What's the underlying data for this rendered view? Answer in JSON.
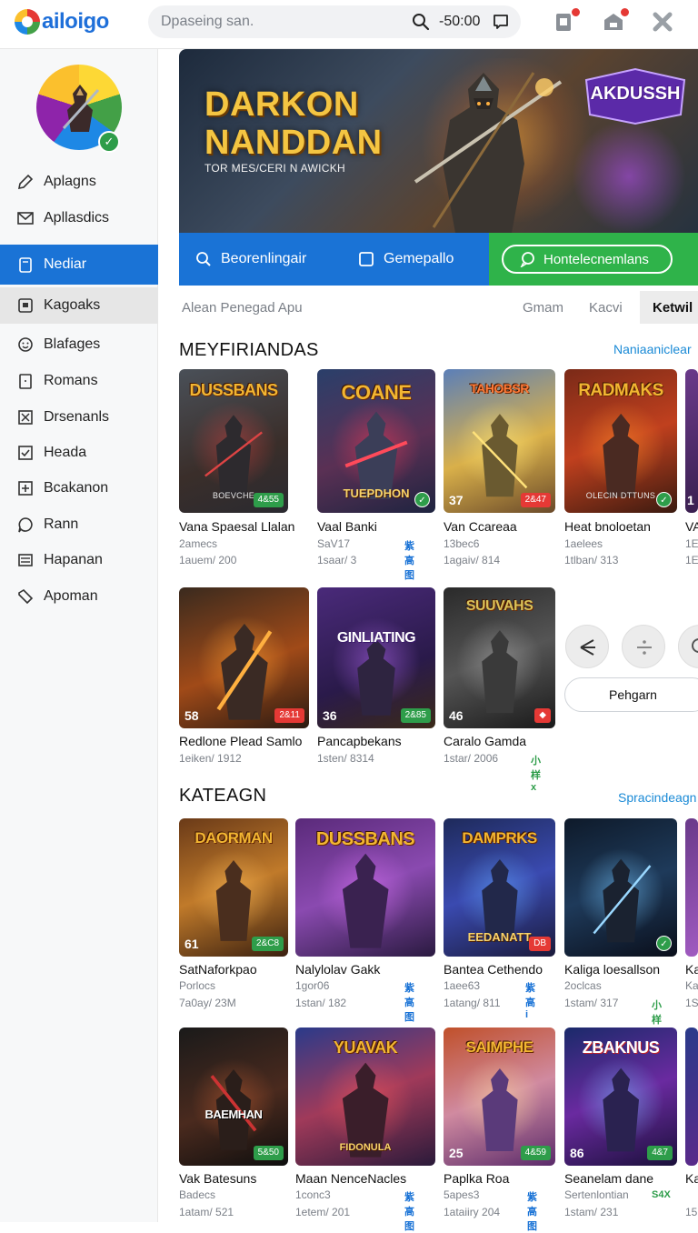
{
  "header": {
    "logo_text": "ailoigo",
    "search_placeholder": "Dpaseing san.",
    "search_time": "-50:00"
  },
  "sidebar": {
    "items": [
      {
        "label": "Aplagns",
        "icon": "edit-icon"
      },
      {
        "label": "Apllasdics",
        "icon": "mail-icon"
      },
      {
        "label": "Nediar",
        "icon": "tablet-icon"
      },
      {
        "label": "Kagoaks",
        "icon": "book-icon"
      },
      {
        "label": "Blafages",
        "icon": "smiley-icon"
      },
      {
        "label": "Romans",
        "icon": "door-icon"
      },
      {
        "label": "Drsenanls",
        "icon": "x-box-icon"
      },
      {
        "label": "Heada",
        "icon": "check-box-icon"
      },
      {
        "label": "Bcakanon",
        "icon": "plus-box-icon"
      },
      {
        "label": "Rann",
        "icon": "chat-icon"
      },
      {
        "label": "Hapanan",
        "icon": "list-icon"
      },
      {
        "label": "Apoman",
        "icon": "tag-icon"
      }
    ]
  },
  "hero": {
    "title_line1": "DARKON",
    "title_line2": "NANDDAN",
    "subtitle": "TOR MES/CERI N AWICKH",
    "badge": "AKDUSSH",
    "slides": 4,
    "active_slide": 1
  },
  "actions": {
    "btn1": "Beorenlingair",
    "btn2": "Gemepallo",
    "btn3": "Hontelecnemlans"
  },
  "filters": {
    "label": "Alean Penegad Apu",
    "tabs": [
      "Gmam",
      "Kacvi",
      "Ketwil"
    ],
    "active_tab": "Ketwil"
  },
  "section1": {
    "title": "MEYFIRIANDAS",
    "link": "Naniaaniclear",
    "cards": [
      {
        "logo": "DUSSBANS",
        "name": "Vana Spaesal Llalan",
        "meta": "2amecs",
        "stat": "1auem/ 200",
        "band": "BOEVCHE",
        "tag_label": "4&55",
        "tag_color": "#2e9d4a",
        "tag_text": ""
      },
      {
        "logo": "COANE",
        "name": "Vaal Banki",
        "meta": "SaV17",
        "stat": "1saar/ 3",
        "band": "TUEPDHON",
        "tag_label": "check",
        "tag_color": "#2e9d4a",
        "tag_text": "紫高图"
      },
      {
        "logo": "TAHOBSR",
        "name": "Van Ccareaa",
        "meta": "13bec6",
        "stat": "1agaiv/ 814",
        "num": "37",
        "tag_label": "2&47",
        "tag_color": "#e53935",
        "tag_text": ""
      },
      {
        "logo": "RADMAKS",
        "name": "Heat bnoloetan",
        "meta": "1aelees",
        "stat": "1tlban/ 313",
        "band": "OLECIN DTTUNS",
        "tag_label": "check",
        "tag_color": "#2e9d4a",
        "tag_text": ""
      },
      {
        "logo": "",
        "name": "VA",
        "meta": "1E",
        "stat": "1E",
        "num": "1",
        "tag_label": "",
        "tag_color": "",
        "tag_text": ""
      }
    ]
  },
  "section1_row2": {
    "cards": [
      {
        "logo": "",
        "name": "Redlone Plead Samlo",
        "meta": "1eiken/ 1912",
        "num": "58",
        "tag_label": "2&11",
        "tag_color": "#e53935"
      },
      {
        "logo": "GINLIATING",
        "name": "Pancapbekans",
        "meta": "1sten/ 8314",
        "num": "36",
        "tag_label": "2&85",
        "tag_color": "#2e9d4a"
      },
      {
        "logo": "SUUVAHS",
        "name": "Caralo Gamda",
        "meta": "1star/ 2006",
        "num": "46",
        "tag_label": "◆",
        "tag_color": "#e53935",
        "tag_text": "小样x"
      }
    ],
    "pill": "Pehgarn"
  },
  "section2": {
    "title": "KATEAGN",
    "link": "Spracindeagn",
    "cards": [
      {
        "logo": "DAORMAN",
        "name": "SatNaforkpao",
        "meta": "Porlocs",
        "stat": "7a0ay/ 23M",
        "num": "61",
        "tag_label": "2&C8",
        "tag_color": "#2e9d4a",
        "tag_text": ""
      },
      {
        "logo": "DUSSBANS",
        "name": "Nalylolav Gakk",
        "meta": "1gor06",
        "stat": "1stan/ 182",
        "tag_label": "",
        "tag_color": "",
        "tag_text": "紫高图"
      },
      {
        "logo": "DAMPRKS",
        "name": "Bantea Cethendo",
        "meta": "1aee63",
        "stat": "1atang/ 811",
        "band": "EEDANATT",
        "tag_label": "DB",
        "tag_color": "#e53935",
        "tag_text": "紫高i"
      },
      {
        "logo": "",
        "name": "Kaliga loesallson",
        "meta": "2oclcas",
        "stat": "1stam/ 317",
        "tag_label": "check",
        "tag_color": "#2e9d4a",
        "tag_text": "小样x"
      },
      {
        "logo": "",
        "name": "Ka",
        "meta": "Ka",
        "stat": "1S",
        "tag_label": "",
        "tag_color": "",
        "tag_text": ""
      }
    ]
  },
  "section2_row2": {
    "cards": [
      {
        "logo": "BAEMHAN",
        "name": "Vak Batesuns",
        "meta": "Badecs",
        "stat": "1atam/ 521",
        "tag_label": "5&50",
        "tag_color": "#2e9d4a",
        "tag_text": ""
      },
      {
        "logo": "YUAVAK",
        "name": "Maan NenceNacles",
        "meta": "1conc3",
        "stat": "1etem/ 201",
        "band": "FIDONULA",
        "tag_label": "",
        "tag_color": "",
        "tag_text": "紫高图"
      },
      {
        "logo": "SAIMPHE",
        "name": "Paplka Roa",
        "meta": "5apes3",
        "stat": "1ataiiry 204",
        "num": "25",
        "tag_label": "4&59",
        "tag_color": "#2e9d4a",
        "tag_text": "紫高图"
      },
      {
        "logo": "ZBAKNUS",
        "name": "Seanelam dane",
        "meta": "Sertenlontian",
        "stat": "1stam/ 231",
        "num": "86",
        "tag_label": "4&7",
        "tag_color": "#2e9d4a",
        "tag_text": "S4X"
      },
      {
        "logo": "",
        "name": "Ka",
        "meta": "",
        "stat": "15",
        "tag_label": "",
        "tag_color": "",
        "tag_text": ""
      }
    ]
  },
  "colors": {
    "primary": "#1a73d6",
    "green": "#2fb34a",
    "link": "#1a8ad6"
  }
}
